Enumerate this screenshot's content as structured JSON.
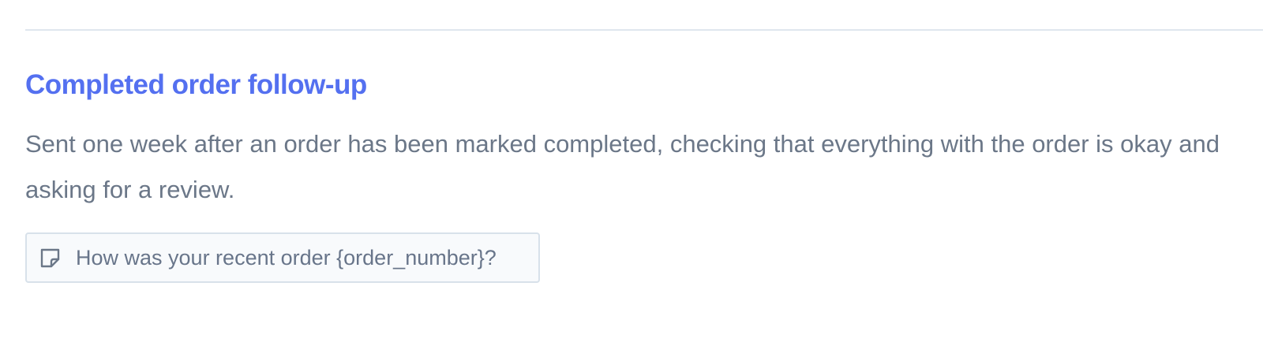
{
  "section": {
    "title": "Completed order follow-up",
    "description": "Sent one week after an order has been marked completed, checking that everything with the order is okay and asking for a review.",
    "subject": {
      "icon": "note-icon",
      "text": "How was your recent order {order_number}?"
    }
  },
  "colors": {
    "title": "#5470f0",
    "body_text": "#6b7788",
    "divider": "#dfe6ee",
    "box_border": "#d8e1ea",
    "box_background": "#f8fafc"
  }
}
